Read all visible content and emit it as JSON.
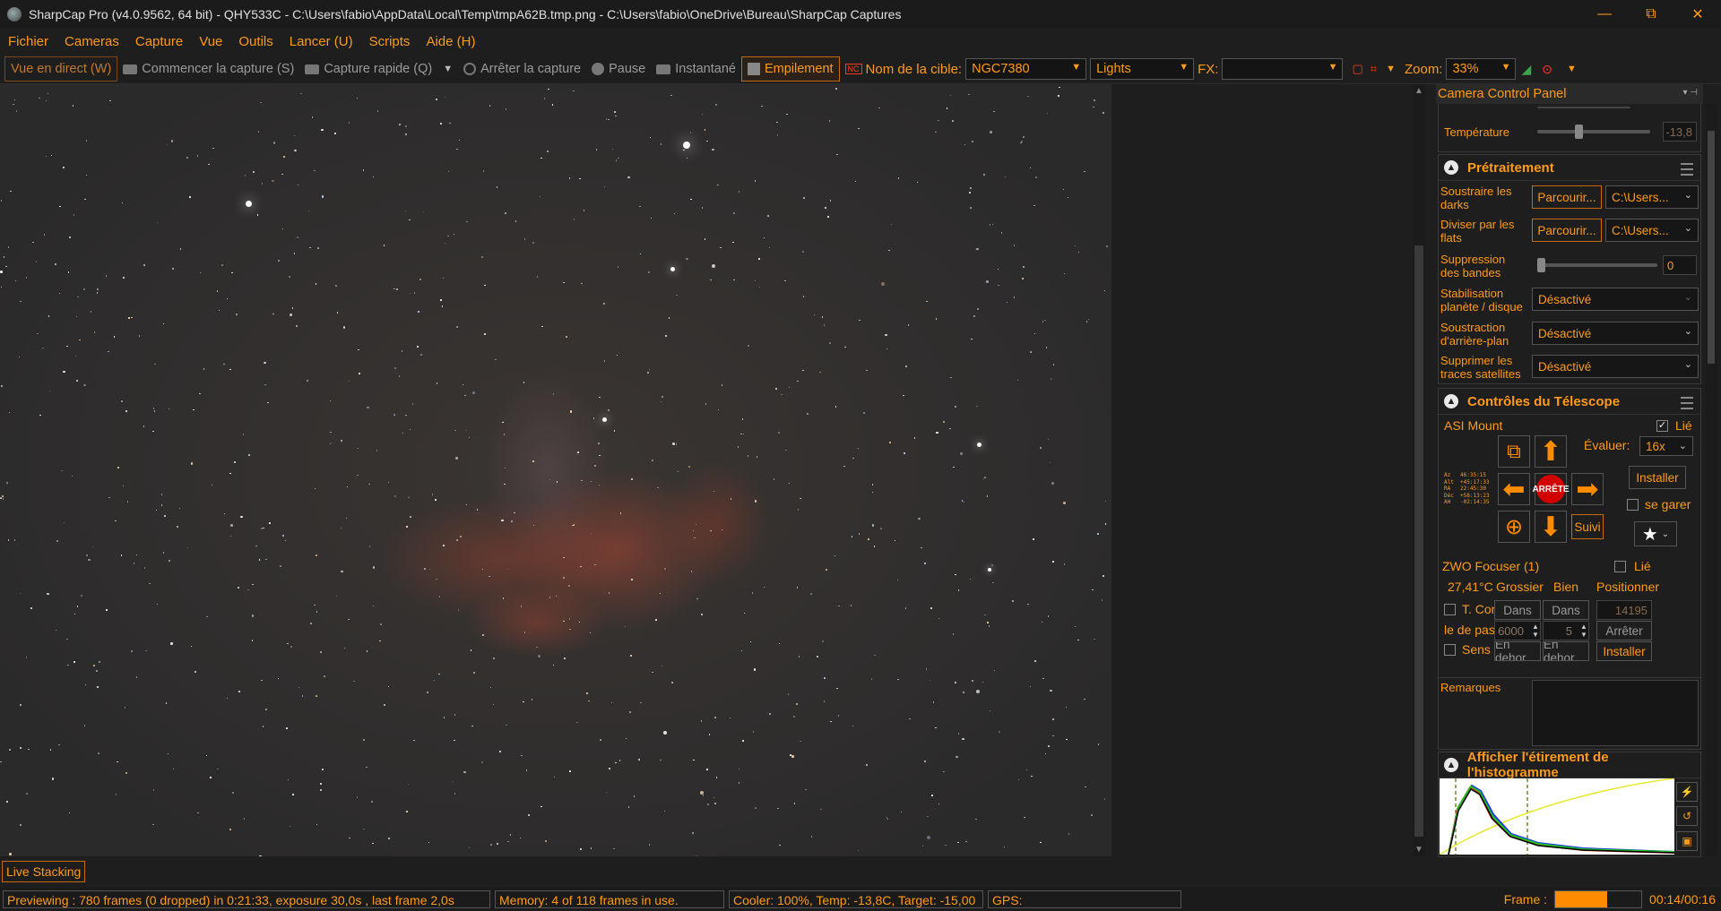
{
  "window": {
    "title": "SharpCap Pro (v4.0.9562, 64 bit) - QHY533C - C:\\Users\\fabio\\AppData\\Local\\Temp\\tmpA62B.tmp.png - C:\\Users\\fabio\\OneDrive\\Bureau\\SharpCap Captures",
    "minimize": "—",
    "maximize": "⧉",
    "close": "✕"
  },
  "menu": [
    "Fichier",
    "Cameras",
    "Capture",
    "Vue",
    "Outils",
    "Lancer (U)",
    "Scripts",
    "Aide (H)"
  ],
  "toolbar": {
    "live_view": "Vue en direct (W)",
    "start_capture": "Commencer la capture (S)",
    "quick_capture": "Capture rapide (Q)",
    "stop_capture": "Arrêter la capture",
    "pause": "Pause",
    "snapshot": "Instantané",
    "stacking": "Empilement",
    "nc_badge": "NC",
    "target_label": "Nom de la cible:",
    "target_value": "NGC7380",
    "frame_type": "Lights",
    "fx_label": "FX:",
    "fx_value": "",
    "zoom_label": "Zoom:",
    "zoom_value": "33%"
  },
  "panel": {
    "title": "Camera Control Panel",
    "temperature_label": "Température",
    "temperature_value": "-13,8",
    "preprocessing": {
      "header": "Prétraitement",
      "darks_label": "Soustraire les darks",
      "flats_label": "Diviser par les flats",
      "browse": "Parcourir...",
      "path": "C:\\Users...",
      "banding_label": "Suppression des bandes",
      "banding_value": "0",
      "stab_label": "Stabilisation planète / disque",
      "bg_label": "Soustraction d'arrière-plan",
      "sat_label": "Supprimer les traces satellites",
      "off": "Désactivé"
    },
    "telescope": {
      "header": "Contrôles du Télescope",
      "mount": "ASI Mount",
      "linked": "Lié",
      "rate_label": "Évaluer:",
      "rate_value": "16x",
      "install": "Installer",
      "park": "se garer",
      "stop": "ARRÊTE",
      "track": "Suivi",
      "coords": "Az   46:35:15\nAlt  +45:17:33\nRA   22:45:30\nDéc  +58:13:23\nAH   -02:14:35"
    },
    "focuser": {
      "name": "ZWO Focuser (1)",
      "linked": "Lié",
      "temp": "27,41°C",
      "coarse": "Grossier",
      "fine": "Bien",
      "position_label": "Positionner",
      "tcomp": "T. Cor",
      "in": "Dans",
      "position_value": "14195",
      "step_label": "le de pas",
      "coarse_step": "6000",
      "fine_step": "5",
      "stop": "Arrêter",
      "reverse": "Sens i",
      "out": "En dehor",
      "install": "Installer"
    },
    "remarks_label": "Remarques",
    "histogram_header": "Afficher l'étirement de l'histogramme"
  },
  "bottom_tab": "Live Stacking",
  "status": {
    "preview": "Previewing : 780 frames (0 dropped) in 0:21:33, exposure 30,0s , last frame 2,0s",
    "memory": "Memory: 4 of 118 frames in use.",
    "cooler": "Cooler: 100%, Temp: -13,8C, Target: -15,00",
    "gps": "GPS:",
    "frame_label": "Frame :",
    "frame_progress": 0.6,
    "frame_time": "00:14/00:16"
  },
  "colors": {
    "accent": "#ff9b1a",
    "stop": "#d20000",
    "background": "#1e1e1e"
  }
}
